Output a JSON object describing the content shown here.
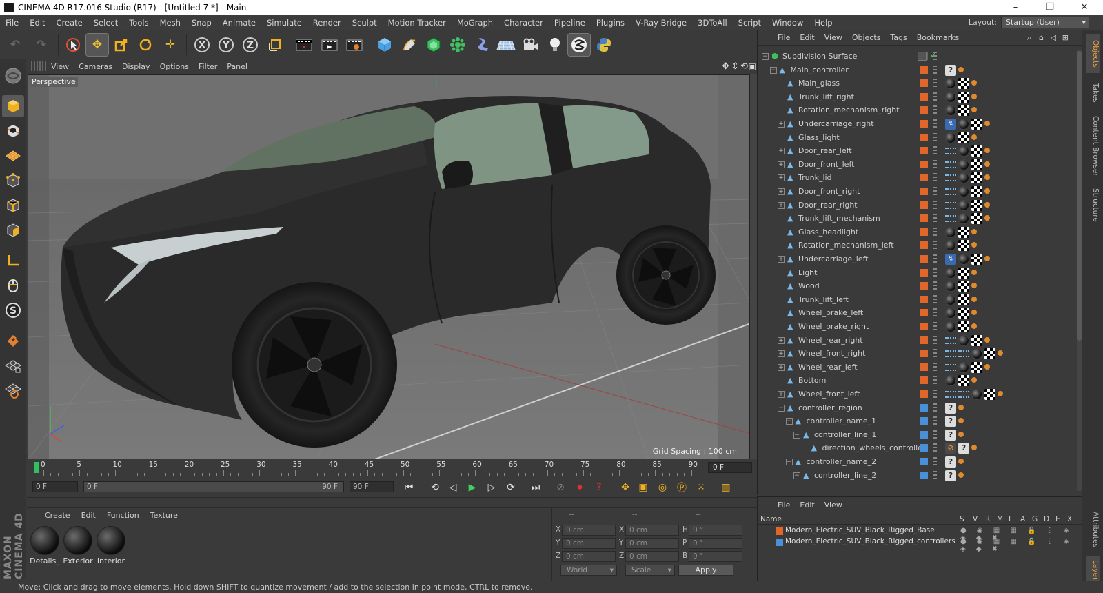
{
  "window": {
    "title": "CINEMA 4D R17.016 Studio (R17) - [Untitled 7 *] - Main",
    "minimize": "–",
    "maximize": "❐",
    "close": "✕"
  },
  "menu": [
    "File",
    "Edit",
    "Create",
    "Select",
    "Tools",
    "Mesh",
    "Snap",
    "Animate",
    "Simulate",
    "Render",
    "Sculpt",
    "Motion Tracker",
    "MoGraph",
    "Character",
    "Pipeline",
    "Plugins",
    "V-Ray Bridge",
    "3DToAll",
    "Script",
    "Window",
    "Help"
  ],
  "layout": {
    "label": "Layout:",
    "value": "Startup (User)"
  },
  "viewport": {
    "menu": [
      "View",
      "Cameras",
      "Display",
      "Options",
      "Filter",
      "Panel"
    ],
    "camera_label": "Perspective",
    "grid_spacing": "Grid Spacing : 100 cm"
  },
  "timeline": {
    "ticks": [
      "0",
      "5",
      "10",
      "15",
      "20",
      "25",
      "30",
      "35",
      "40",
      "45",
      "50",
      "55",
      "60",
      "65",
      "70",
      "75",
      "80",
      "85",
      "90"
    ],
    "current_frame": "0 F"
  },
  "transport": {
    "start": "0 F",
    "range_start": "0 F",
    "range_end": "90 F",
    "end": "90 F"
  },
  "material_menu": [
    "Create",
    "Edit",
    "Function",
    "Texture"
  ],
  "materials": [
    "Details_",
    "Exterior",
    "Interior"
  ],
  "coords": {
    "headers": [
      "--",
      "--",
      "--"
    ],
    "rows": [
      {
        "a": "X",
        "av": "0 cm",
        "b": "X",
        "bv": "0 cm",
        "c": "H",
        "cv": "0 °"
      },
      {
        "a": "Y",
        "av": "0 cm",
        "b": "Y",
        "bv": "0 cm",
        "c": "P",
        "cv": "0 °"
      },
      {
        "a": "Z",
        "av": "0 cm",
        "b": "Z",
        "bv": "0 cm",
        "c": "B",
        "cv": "0 °"
      }
    ],
    "space": "World",
    "mode": "Scale",
    "apply": "Apply"
  },
  "object_manager": {
    "menu": [
      "File",
      "Edit",
      "View",
      "Objects",
      "Tags",
      "Bookmarks"
    ],
    "objects": [
      {
        "name": "Subdivision Surface",
        "level": 0,
        "exp": "−",
        "color": "none",
        "icon": "sds"
      },
      {
        "name": "Main_controller",
        "level": 1,
        "exp": "−",
        "color": "#e0662a",
        "icon": "null"
      },
      {
        "name": "Main_glass",
        "level": 2,
        "exp": "",
        "color": "#e0662a",
        "icon": "poly"
      },
      {
        "name": "Trunk_lift_right",
        "level": 2,
        "exp": "",
        "color": "#e0662a",
        "icon": "poly"
      },
      {
        "name": "Rotation_mechanism_right",
        "level": 2,
        "exp": "",
        "color": "#e0662a",
        "icon": "poly"
      },
      {
        "name": "Undercarriage_right",
        "level": 2,
        "exp": "+",
        "color": "#e0662a",
        "icon": "poly"
      },
      {
        "name": "Glass_light",
        "level": 2,
        "exp": "",
        "color": "#e0662a",
        "icon": "poly"
      },
      {
        "name": "Door_rear_left",
        "level": 2,
        "exp": "+",
        "color": "#e0662a",
        "icon": "poly"
      },
      {
        "name": "Door_front_left",
        "level": 2,
        "exp": "+",
        "color": "#e0662a",
        "icon": "poly"
      },
      {
        "name": "Trunk_lid",
        "level": 2,
        "exp": "+",
        "color": "#e0662a",
        "icon": "poly"
      },
      {
        "name": "Door_front_right",
        "level": 2,
        "exp": "+",
        "color": "#e0662a",
        "icon": "poly"
      },
      {
        "name": "Door_rear_right",
        "level": 2,
        "exp": "+",
        "color": "#e0662a",
        "icon": "poly"
      },
      {
        "name": "Trunk_lift_mechanism",
        "level": 2,
        "exp": "",
        "color": "#e0662a",
        "icon": "poly"
      },
      {
        "name": "Glass_headlight",
        "level": 2,
        "exp": "",
        "color": "#e0662a",
        "icon": "poly"
      },
      {
        "name": "Rotation_mechanism_left",
        "level": 2,
        "exp": "",
        "color": "#e0662a",
        "icon": "poly"
      },
      {
        "name": "Undercarriage_left",
        "level": 2,
        "exp": "+",
        "color": "#e0662a",
        "icon": "poly"
      },
      {
        "name": "Light",
        "level": 2,
        "exp": "",
        "color": "#e0662a",
        "icon": "poly"
      },
      {
        "name": "Wood",
        "level": 2,
        "exp": "",
        "color": "#e0662a",
        "icon": "poly"
      },
      {
        "name": "Trunk_lift_left",
        "level": 2,
        "exp": "",
        "color": "#e0662a",
        "icon": "poly"
      },
      {
        "name": "Wheel_brake_left",
        "level": 2,
        "exp": "",
        "color": "#e0662a",
        "icon": "poly"
      },
      {
        "name": "Wheel_brake_right",
        "level": 2,
        "exp": "",
        "color": "#e0662a",
        "icon": "poly"
      },
      {
        "name": "Wheel_rear_right",
        "level": 2,
        "exp": "+",
        "color": "#e0662a",
        "icon": "poly"
      },
      {
        "name": "Wheel_front_right",
        "level": 2,
        "exp": "+",
        "color": "#e0662a",
        "icon": "poly"
      },
      {
        "name": "Wheel_rear_left",
        "level": 2,
        "exp": "+",
        "color": "#e0662a",
        "icon": "poly"
      },
      {
        "name": "Bottom",
        "level": 2,
        "exp": "",
        "color": "#e0662a",
        "icon": "poly"
      },
      {
        "name": "Wheel_front_left",
        "level": 2,
        "exp": "+",
        "color": "#e0662a",
        "icon": "poly"
      },
      {
        "name": "controller_region",
        "level": 2,
        "exp": "−",
        "color": "#4a90d9",
        "icon": "null"
      },
      {
        "name": "controller_name_1",
        "level": 3,
        "exp": "−",
        "color": "#4a90d9",
        "icon": "null"
      },
      {
        "name": "controller_line_1",
        "level": 4,
        "exp": "−",
        "color": "#4a90d9",
        "icon": "null"
      },
      {
        "name": "direction_wheels_controller",
        "level": 5,
        "exp": "",
        "color": "#4a90d9",
        "icon": "null"
      },
      {
        "name": "controller_name_2",
        "level": 3,
        "exp": "−",
        "color": "#4a90d9",
        "icon": "null"
      },
      {
        "name": "controller_line_2",
        "level": 4,
        "exp": "−",
        "color": "#4a90d9",
        "icon": "null"
      }
    ]
  },
  "layer_manager": {
    "menu": [
      "File",
      "Edit",
      "View"
    ],
    "columns": [
      "Name",
      "S",
      "V",
      "R",
      "M",
      "L",
      "A",
      "G",
      "D",
      "E",
      "X"
    ],
    "layers": [
      {
        "name": "Modern_Electric_SUV_Black_Rigged_Base",
        "color": "#e0662a"
      },
      {
        "name": "Modern_Electric_SUV_Black_Rigged_controllers",
        "color": "#4a90d9"
      }
    ]
  },
  "right_tabs": [
    "Objects",
    "Takes",
    "Content Browser",
    "Structure",
    "Attributes",
    "Layers"
  ],
  "brand": "MAXON CINEMA 4D",
  "status": "Move: Click and drag to move elements. Hold down SHIFT to quantize movement / add to the selection in point mode, CTRL to remove."
}
